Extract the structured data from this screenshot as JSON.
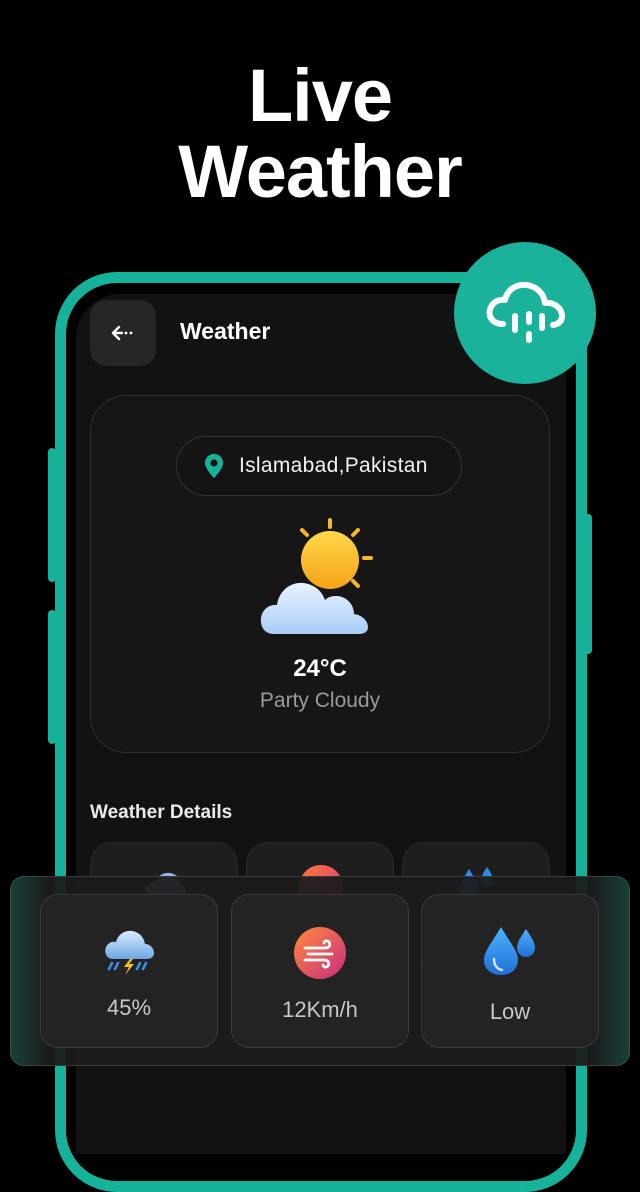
{
  "headline": {
    "line1": "Live",
    "line2": "Weather"
  },
  "screen": {
    "title": "Weather"
  },
  "location": {
    "name": "Islamabad,Pakistan"
  },
  "current": {
    "temperature": "24°C",
    "condition": "Party Cloudy"
  },
  "details": {
    "section_title": "Weather Details",
    "items": [
      {
        "icon": "storm-cloud-icon",
        "value": "45%"
      },
      {
        "icon": "wind-icon",
        "value": "12Km/h"
      },
      {
        "icon": "water-drops-icon",
        "value": "Low"
      }
    ]
  },
  "colors": {
    "accent": "#16b39a",
    "background": "#000000",
    "screen": "#121212"
  }
}
